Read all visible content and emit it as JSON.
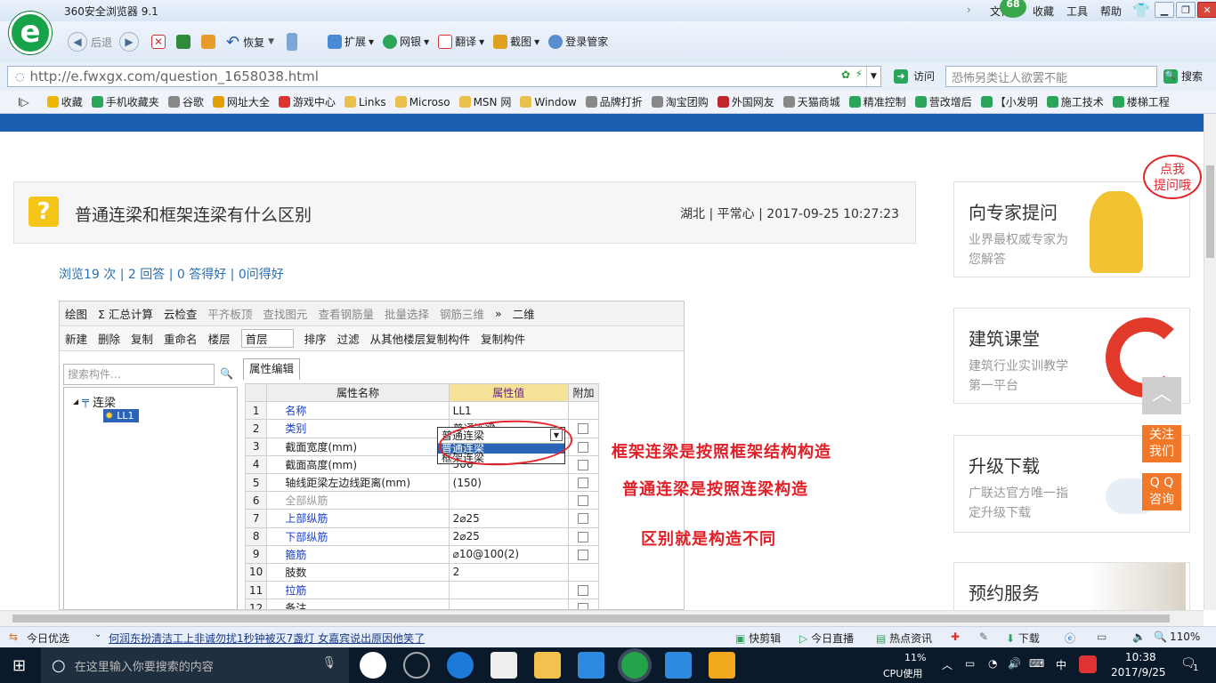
{
  "browser": {
    "title": "360安全浏览器 9.1",
    "menu": [
      "文件",
      "收藏",
      "工具",
      "帮助"
    ],
    "badge": "68",
    "logo_text": "e"
  },
  "nav": {
    "back": "后退",
    "restore": "恢复",
    "items": [
      "扩展",
      "网银",
      "翻译",
      "截图",
      "登录管家"
    ]
  },
  "address": {
    "url": "http://e.fwxgx.com/question_1658038.html",
    "visit": "访问",
    "search_placeholder": "恐怖另类让人欲罢不能",
    "search_btn": "搜索"
  },
  "favorites": [
    "收藏",
    "手机收藏夹",
    "谷歌",
    "网址大全",
    "游戏中心",
    "Links",
    "Microso",
    "MSN 网",
    "Window",
    "品牌打折",
    "淘宝团购",
    "外国网友",
    "天猫商城",
    "精准控制",
    "营改增后",
    "【小发明",
    "施工技术",
    "楼梯工程"
  ],
  "question": {
    "icon": "?",
    "title": "普通连梁和框架连梁有什么区别",
    "meta": "湖北 | 平常心 | 2017-09-25 10:27:23",
    "stats": "浏览19 次 | 2 回答 | 0 答得好 | 0问得好"
  },
  "software": {
    "toolbar1": [
      "绘图",
      "Σ 汇总计算",
      "云检查",
      "平齐板顶",
      "查找图元",
      "查看钢筋量",
      "批量选择",
      "钢筋三维",
      "»",
      "二维"
    ],
    "toolbar2": [
      "新建",
      "删除",
      "复制",
      "重命名",
      "楼层",
      "首层",
      "排序",
      "过滤",
      "从其他楼层复制构件",
      "复制构件"
    ],
    "search_placeholder": "搜索构件...",
    "tree_root": "连梁",
    "tree_child": "LL1",
    "tab": "属性编辑",
    "headers": [
      "属性名称",
      "属性值",
      "附加"
    ],
    "rows": [
      {
        "n": "1",
        "k": "名称",
        "v": "LL1",
        "a": false,
        "blue": true
      },
      {
        "n": "2",
        "k": "类别",
        "v": "普通连梁",
        "a": true,
        "blue": true
      },
      {
        "n": "3",
        "k": "截面宽度(mm)",
        "v": "",
        "a": true,
        "blue": false
      },
      {
        "n": "4",
        "k": "截面高度(mm)",
        "v": "500",
        "a": true,
        "blue": false
      },
      {
        "n": "5",
        "k": "轴线距梁左边线距离(mm)",
        "v": "(150)",
        "a": true,
        "blue": false
      },
      {
        "n": "6",
        "k": "全部纵筋",
        "v": "",
        "a": true,
        "gray": true
      },
      {
        "n": "7",
        "k": "上部纵筋",
        "v": "2⌀25",
        "a": true,
        "blue": true
      },
      {
        "n": "8",
        "k": "下部纵筋",
        "v": "2⌀25",
        "a": true,
        "blue": true
      },
      {
        "n": "9",
        "k": "箍筋",
        "v": "⌀10@100(2)",
        "a": true,
        "blue": true
      },
      {
        "n": "10",
        "k": "肢数",
        "v": "2",
        "a": false,
        "blue": false
      },
      {
        "n": "11",
        "k": "拉筋",
        "v": "",
        "a": true,
        "blue": true
      },
      {
        "n": "12",
        "k": "备注",
        "v": "",
        "a": true,
        "blue": false
      }
    ],
    "dropdown": [
      "普通连梁",
      "框架连梁"
    ]
  },
  "annotations": [
    "框架连梁是按照框架结构构造",
    "普通连梁是按照连梁构造",
    "区别就是构造不同"
  ],
  "sidebar": {
    "bubble": "点我\n提问哦",
    "cards": [
      {
        "title": "向专家提问",
        "sub": "业界最权威专家为您解答"
      },
      {
        "title": "建筑课堂",
        "sub": "建筑行业实训教学第一平台"
      },
      {
        "title": "升级下载",
        "sub": "广联达官方唯一指定升级下载"
      },
      {
        "title": "预约服务",
        "sub": ""
      }
    ],
    "follow": "关注\n我们",
    "qq": "Q Q\n咨询"
  },
  "status": {
    "left": "今日优选",
    "news": "何润东扮清洁工上非诚勿扰1秒钟被灭7盏灯 女嘉宾说出原因他笑了",
    "items": [
      "快剪辑",
      "今日直播",
      "热点资讯",
      "下载"
    ],
    "zoom": "110%"
  },
  "taskbar": {
    "search": "在这里输入你要搜索的内容",
    "cpu": "11%",
    "cpu_label": "CPU使用",
    "ime": "中",
    "time": "10:38",
    "date": "2017/9/25",
    "notify": "1"
  }
}
